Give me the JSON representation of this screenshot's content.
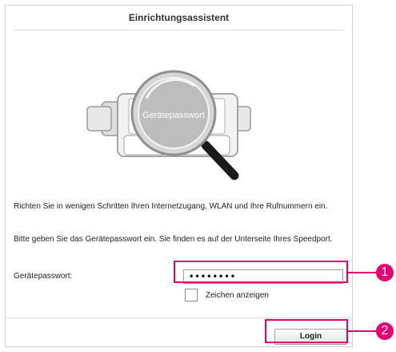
{
  "dialog": {
    "title": "Einrichtungsassistent"
  },
  "illustration": {
    "lens_text": "Gerätepasswort",
    "icon": "magnifier-icon"
  },
  "intro_text": "Richten Sie in wenigen Schritten Ihren Internetzugang, WLAN und Ihre Rufnummern ein.",
  "hint_text": "Bitte geben Sie das Gerätepasswort ein. Sie finden es auf der Unterseite Ihres Speedport.",
  "password": {
    "label": "Gerätepasswort:",
    "value": "••••••••",
    "masked": true
  },
  "show_chars": {
    "label": "Zeichen anzeigen",
    "checked": false
  },
  "login_button": {
    "label": "Login"
  },
  "callouts": [
    {
      "number": "1"
    },
    {
      "number": "2"
    }
  ],
  "colors": {
    "highlight": "#e20074",
    "border": "#cfcfcf"
  }
}
